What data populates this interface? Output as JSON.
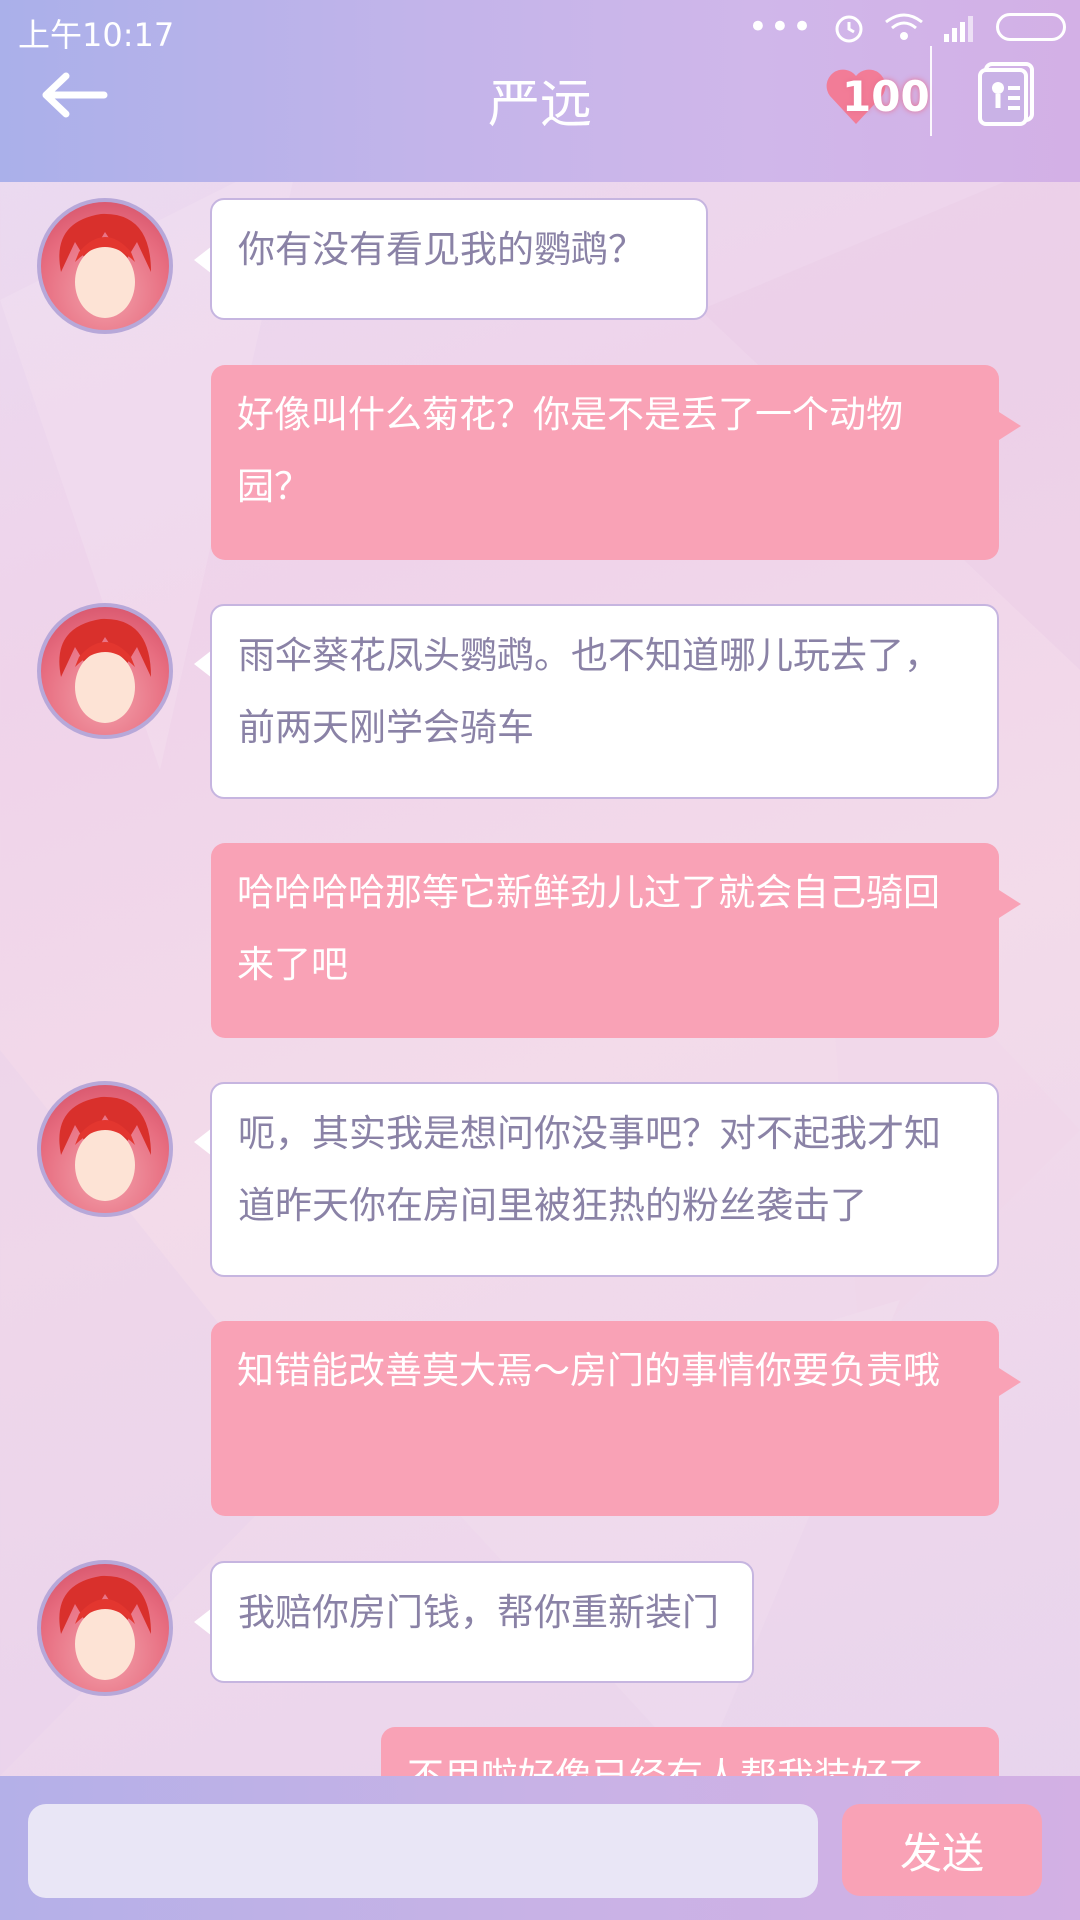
{
  "status_bar": {
    "time": "上午10:17",
    "dots": "•••"
  },
  "header": {
    "title": "严远",
    "heart_count": "100"
  },
  "messages": [
    {
      "side": "in",
      "text": "你有没有看见我的鹦鹉？"
    },
    {
      "side": "out",
      "text": "好像叫什么菊花？你是不是丢了一个动物园？"
    },
    {
      "side": "in",
      "text": "雨伞葵花凤头鹦鹉。也不知道哪儿玩去了，前两天刚学会骑车"
    },
    {
      "side": "out",
      "text": "哈哈哈哈那等它新鲜劲儿过了就会自己骑回来了吧"
    },
    {
      "side": "in",
      "text": "呃，其实我是想问你没事吧？对不起我才知道昨天你在房间里被狂热的粉丝袭击了"
    },
    {
      "side": "out",
      "text": "知错能改善莫大焉～房门的事情你要负责哦"
    },
    {
      "side": "in",
      "text": "我赔你房门钱，帮你重新装门"
    },
    {
      "side": "out",
      "text": "不用啦好像已经有人帮我装好了"
    }
  ],
  "input": {
    "placeholder": "",
    "send_label": "发送"
  },
  "colors": {
    "incoming_bubble": "#ffffff",
    "outgoing_bubble": "#f9a2b6",
    "header": "#c3b4ea"
  },
  "icons": [
    "back-arrow-icon",
    "heart-icon",
    "profile-card-icon",
    "alarm-icon",
    "wifi-icon",
    "signal-icon",
    "battery-icon"
  ]
}
